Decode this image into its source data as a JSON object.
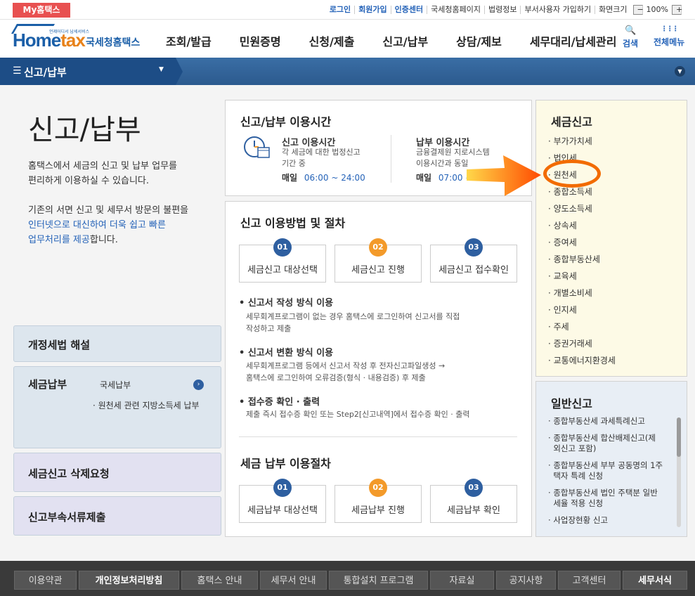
{
  "topbar": {
    "mytax": "My홈택스",
    "links": [
      "로그인",
      "회원가입",
      "인증센터",
      "국세청홈페이지",
      "법령정보",
      "부서사용자 가입하기",
      "화면크기"
    ],
    "zoom_minus": "−",
    "zoom": "100%",
    "zoom_plus": "+"
  },
  "header": {
    "logo_small": "언제어디서 납세서비스",
    "logo_home": "Home",
    "logo_tax": "tax",
    "logo_kor": "국세청홈택스",
    "gnb": [
      "조회/발급",
      "민원증명",
      "신청/제출",
      "신고/납부",
      "상담/제보",
      "세무대리/납세관리"
    ],
    "search_label": "검색",
    "allmenu_label": "전체메뉴",
    "search_icon": "🔍",
    "allmenu_icon": "⋮⋮⋮"
  },
  "nav": {
    "current": "신고/납부"
  },
  "page": {
    "title": "신고/납부",
    "intro1": "홈택스에서 세금의 신고 및 납부 업무를",
    "intro2": "편리하게 이용하실 수 있습니다.",
    "intro3": "기존의 서면 신고 및 세무서 방문의 불편을",
    "intro4_hl": "인터넷으로 대신하여 더욱 쉽고 빠른",
    "intro5_hl": "업무처리를 제공",
    "intro5_rest": "합니다."
  },
  "left_boxes": {
    "b1": "개정세법 해설",
    "b2": "세금납부",
    "b2_link": "국세납부",
    "b2_sub": "· 원천세 관련 지방소득세 납부",
    "b3": "세금신고 삭제요청",
    "b4": "신고부속서류제출"
  },
  "hours": {
    "title": "신고/납부 이용시간",
    "report_title": "신고 이용시간",
    "report_desc1": "각 세금에 대한 법정신고",
    "report_desc2": "기간 중",
    "report_daily": "매일",
    "report_time": "06:00 ~ 24:00",
    "pay_title": "납부 이용시간",
    "pay_desc1": "금융결제원 지로시스템",
    "pay_desc2": "이용시간과 동일",
    "pay_daily": "매일",
    "pay_time": "07:00 ~ 23:30"
  },
  "method": {
    "title": "신고 이용방법 및 절차",
    "steps": [
      {
        "num": "01",
        "label": "세금신고 대상선택"
      },
      {
        "num": "02",
        "label": "세금신고 진행"
      },
      {
        "num": "03",
        "label": "세금신고 접수확인"
      }
    ],
    "b1": "신고서 작성 방식 이용",
    "b1_d1": "세무회계프로그램이 없는 경우 홈택스에 로그인하여 신고서를 직접",
    "b1_d2": "작성하고 제출",
    "b2": "신고서 변환 방식 이용",
    "b2_d1": "세무회계프로그램 등에서 신고서 작성 후 전자신고파일생성 →",
    "b2_d2": "홈택스에 로그인하여 오류검증(형식 · 내용검증) 후 제출",
    "b3": "접수증 확인 · 출력",
    "b3_d1": "제출 즉시 접수증 확인 또는 Step2[신고내역]에서 접수증 확인 · 출력",
    "pay_title": "세금 납부 이용절차",
    "pay_steps": [
      {
        "num": "01",
        "label": "세금납부 대상선택"
      },
      {
        "num": "02",
        "label": "세금납부 진행"
      },
      {
        "num": "03",
        "label": "세금납부 확인"
      }
    ]
  },
  "tax_report": {
    "title": "세금신고",
    "items": [
      "부가가치세",
      "법인세",
      "원천세",
      "종합소득세",
      "양도소득세",
      "상속세",
      "증여세",
      "종합부동산세",
      "교육세",
      "개별소비세",
      "인지세",
      "주세",
      "증권거래세",
      "교통에너지환경세"
    ]
  },
  "general_report": {
    "title": "일반신고",
    "items": [
      [
        "종합부동산세 과세특례신고"
      ],
      [
        "종합부동산세 합산배제신고(제",
        "외신고 포함)"
      ],
      [
        "종합부동산세 부부 공동명의 1주",
        "택자 특례 신청"
      ],
      [
        "종합부동산세 법인 주택분 일반",
        "세율 적용 신청"
      ],
      [
        "사업장현황 신고"
      ]
    ]
  },
  "footer": [
    "이용약관",
    "개인정보처리방침",
    "홈택스 안내",
    "세무서 안내",
    "통합설치 프로그램",
    "자료실",
    "공지사항",
    "고객센터",
    "세무서식"
  ],
  "colors": {
    "accent": "#2563b8",
    "brand_red": "#e85050",
    "annotation": "#f26b00"
  }
}
